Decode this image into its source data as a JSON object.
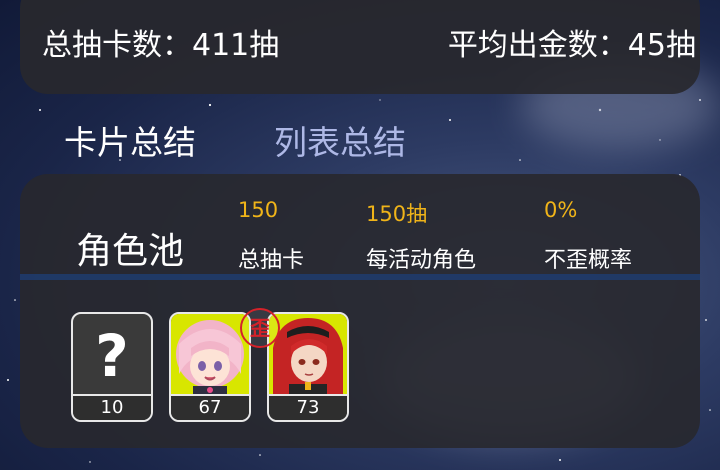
{
  "summary": {
    "total_pulls_text": "总抽卡数：411抽",
    "avg_gold_text": "平均出金数：45抽"
  },
  "tabs": [
    {
      "label": "卡片总结",
      "active": true
    },
    {
      "label": "列表总结",
      "active": false
    }
  ],
  "pool": {
    "name": "角色池",
    "stats": [
      {
        "value": "150",
        "label": "总抽卡"
      },
      {
        "value": "150抽",
        "label": "每活动角色"
      },
      {
        "value": "0%",
        "label": "不歪概率"
      }
    ],
    "cards": [
      {
        "type": "unknown",
        "glyph": "?",
        "count": "10"
      },
      {
        "type": "character",
        "icon": "pink-hair-character-portrait",
        "count": "67",
        "badge": "歪"
      },
      {
        "type": "character",
        "icon": "red-hair-character-portrait",
        "count": "73"
      }
    ]
  },
  "colors": {
    "accent_value": "#f0b419",
    "tab_inactive": "#aeb8e6",
    "badge_red": "#d4222a",
    "portrait_bg": "#d8e600"
  }
}
